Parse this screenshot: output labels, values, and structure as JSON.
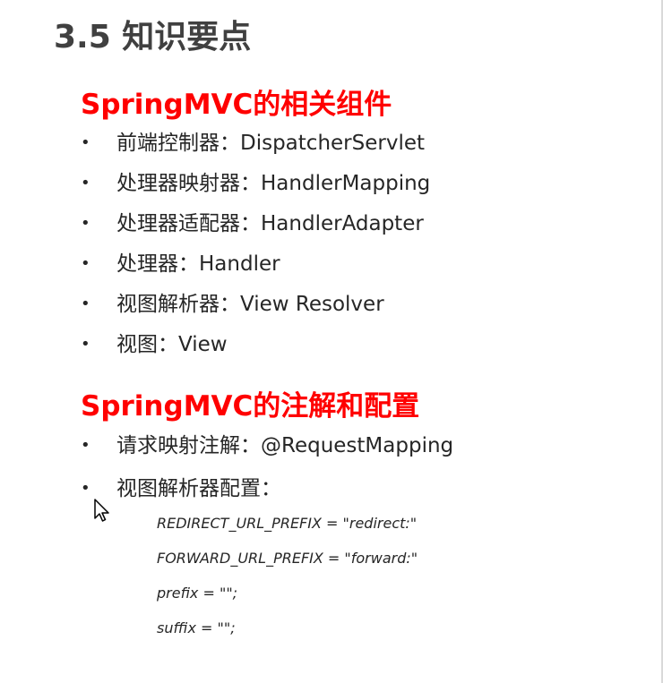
{
  "slide": {
    "title": "3.5 知识要点",
    "sections": [
      {
        "heading": "SpringMVC的相关组件",
        "items": [
          "前端控制器：DispatcherServlet",
          "处理器映射器：HandlerMapping",
          "处理器适配器：HandlerAdapter",
          "处理器：Handler",
          "视图解析器：View Resolver",
          "视图：View"
        ]
      },
      {
        "heading": "SpringMVC的注解和配置",
        "items": [
          "请求映射注解：@RequestMapping",
          "视图解析器配置："
        ]
      }
    ],
    "code_lines": [
      "REDIRECT_URL_PREFIX = \"redirect:\"",
      "FORWARD_URL_PREFIX = \"forward:\"",
      "prefix = \"\";",
      "suffix = \"\";"
    ],
    "bullet_glyph": "•"
  },
  "colors": {
    "title": "#404040",
    "heading": "#ff0000",
    "body_text": "#262626",
    "background": "#ffffff"
  },
  "icons": {
    "cursor": "mouse-pointer-icon"
  }
}
